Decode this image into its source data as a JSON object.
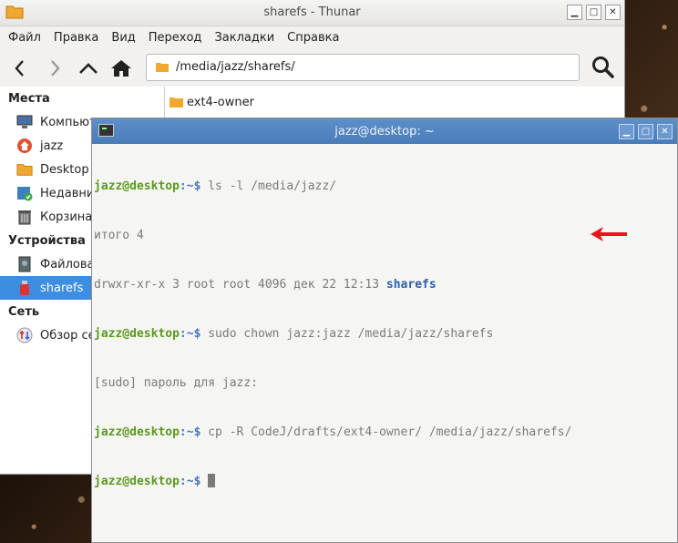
{
  "thunar": {
    "title": "sharefs - Thunar",
    "menu": [
      "Файл",
      "Правка",
      "Вид",
      "Переход",
      "Закладки",
      "Справка"
    ],
    "path": "/media/jazz/sharefs/",
    "sidebar": {
      "places_header": "Места",
      "places": [
        {
          "label": "Компьютер",
          "icon": "computer-icon"
        },
        {
          "label": "jazz",
          "icon": "home-icon"
        },
        {
          "label": "Desktop",
          "icon": "desktop-folder-icon"
        },
        {
          "label": "Недавние",
          "icon": "recent-icon"
        },
        {
          "label": "Корзина",
          "icon": "trash-icon"
        }
      ],
      "devices_header": "Устройства",
      "devices": [
        {
          "label": "Файловая система",
          "icon": "drive-icon"
        },
        {
          "label": "sharefs",
          "icon": "usb-drive-icon",
          "selected": true
        }
      ],
      "network_header": "Сеть",
      "network": [
        {
          "label": "Обзор сети",
          "icon": "network-icon"
        }
      ]
    },
    "files": [
      "ext4-owner"
    ]
  },
  "terminal": {
    "title": "jazz@desktop: ~",
    "prompt_user": "jazz@desktop",
    "prompt_path": ":~$",
    "lines": [
      {
        "type": "cmd",
        "text": " ls -l /media/jazz/"
      },
      {
        "type": "out",
        "text": "итого 4"
      },
      {
        "type": "out_dir",
        "text": "drwxr-xr-x 3 root root 4096 дек 22 12:13 ",
        "dir": "sharefs"
      },
      {
        "type": "cmd",
        "text": " sudo chown jazz:jazz /media/jazz/sharefs"
      },
      {
        "type": "out",
        "text": "[sudo] пароль для jazz:"
      },
      {
        "type": "cmd",
        "text": " cp -R CodeJ/drafts/ext4-owner/ /media/jazz/sharefs/"
      },
      {
        "type": "cmd_cursor",
        "text": " "
      }
    ]
  },
  "colors": {
    "accent": "#3d8ee0",
    "terminal_title": "#4a7cb8",
    "prompt_user": "#5a9a1a",
    "annotation_arrow": "#e8161a"
  }
}
